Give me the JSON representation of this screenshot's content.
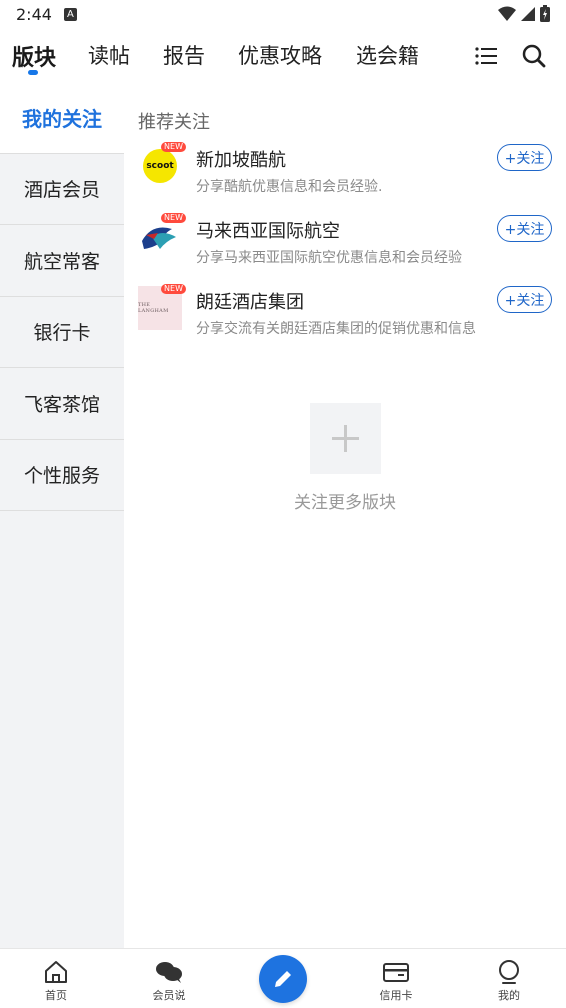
{
  "status_bar": {
    "time": "2:44",
    "a_badge": "A"
  },
  "top_tabs": [
    {
      "label": "版块",
      "active": true
    },
    {
      "label": "读帖"
    },
    {
      "label": "报告"
    },
    {
      "label": "优惠攻略"
    },
    {
      "label": "选会籍"
    }
  ],
  "sidebar": {
    "items": [
      {
        "label": "我的关注",
        "active": true
      },
      {
        "label": "酒店会员"
      },
      {
        "label": "航空常客"
      },
      {
        "label": "银行卡"
      },
      {
        "label": "飞客茶馆"
      },
      {
        "label": "个性服务"
      }
    ]
  },
  "main": {
    "section_title": "推荐关注",
    "follow_label": "+关注",
    "recommendations": [
      {
        "name": "新加坡酷航",
        "desc": "分享酷航优惠信息和会员经验.",
        "logo_text": "scoot",
        "badge": "NEW"
      },
      {
        "name": "马来西亚国际航空",
        "desc": "分享马来西亚国际航空优惠信息和会员经验",
        "badge": "NEW"
      },
      {
        "name": "朗廷酒店集团",
        "desc": "分享交流有关朗廷酒店集团的促销优惠和信息",
        "logo_text": "THE LANGHAM",
        "badge": "NEW"
      }
    ],
    "add_more_label": "关注更多版块"
  },
  "bottom_nav": [
    {
      "label": "首页",
      "icon": "home-icon"
    },
    {
      "label": "会员说",
      "icon": "chat-bubbles-icon"
    },
    {
      "label": "",
      "icon": "pencil-icon"
    },
    {
      "label": "信用卡",
      "icon": "card-icon"
    },
    {
      "label": "我的",
      "icon": "profile-icon"
    }
  ],
  "colors": {
    "accent": "#1f72dd",
    "fab": "#1e73e0",
    "sidebar_bg": "#f2f3f5"
  }
}
